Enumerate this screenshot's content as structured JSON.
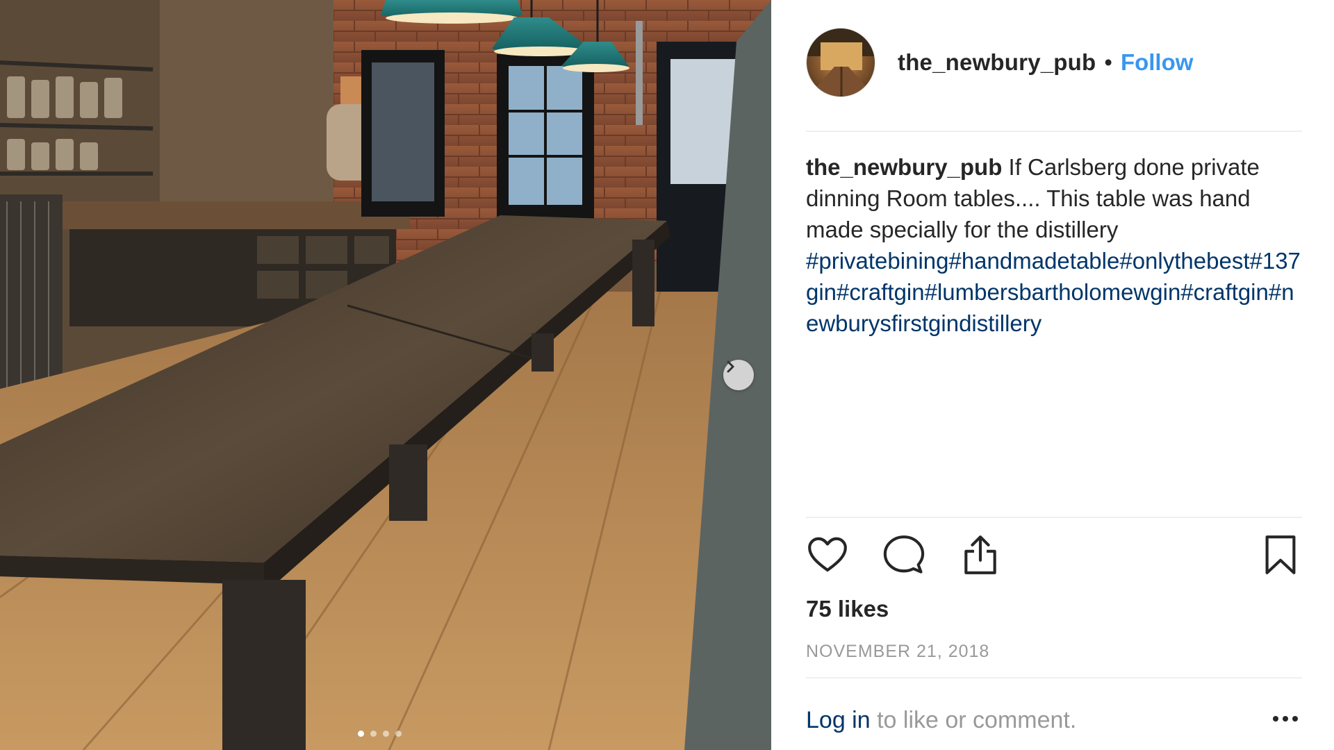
{
  "post": {
    "username": "the_newbury_pub",
    "separator": "•",
    "follow_label": "Follow",
    "caption_user": "the_newbury_pub",
    "caption_text": "If Carlsberg done private dinning Room tables.... This table was hand made specially for the distillery",
    "hashtags": "#privatebining#handmadetable#onlythebest#137gin#craftgin#lumbersbartholomewgin#craftgin#newburysfirstgindistillery",
    "likes": "75 likes",
    "date": "NOVEMBER 21, 2018"
  },
  "footer": {
    "login_link": "Log in",
    "login_suffix": " to like or comment."
  },
  "carousel": {
    "total_slides": 4,
    "active_slide": 1
  },
  "icons": {
    "like": "heart-icon",
    "comment": "comment-icon",
    "share": "share-icon",
    "save": "bookmark-icon",
    "more": "more-options-icon",
    "next": "chevron-right-icon"
  },
  "colors": {
    "link_blue": "#3897f0",
    "hashtag_blue": "#003569",
    "text": "#262626",
    "muted": "#999999"
  }
}
